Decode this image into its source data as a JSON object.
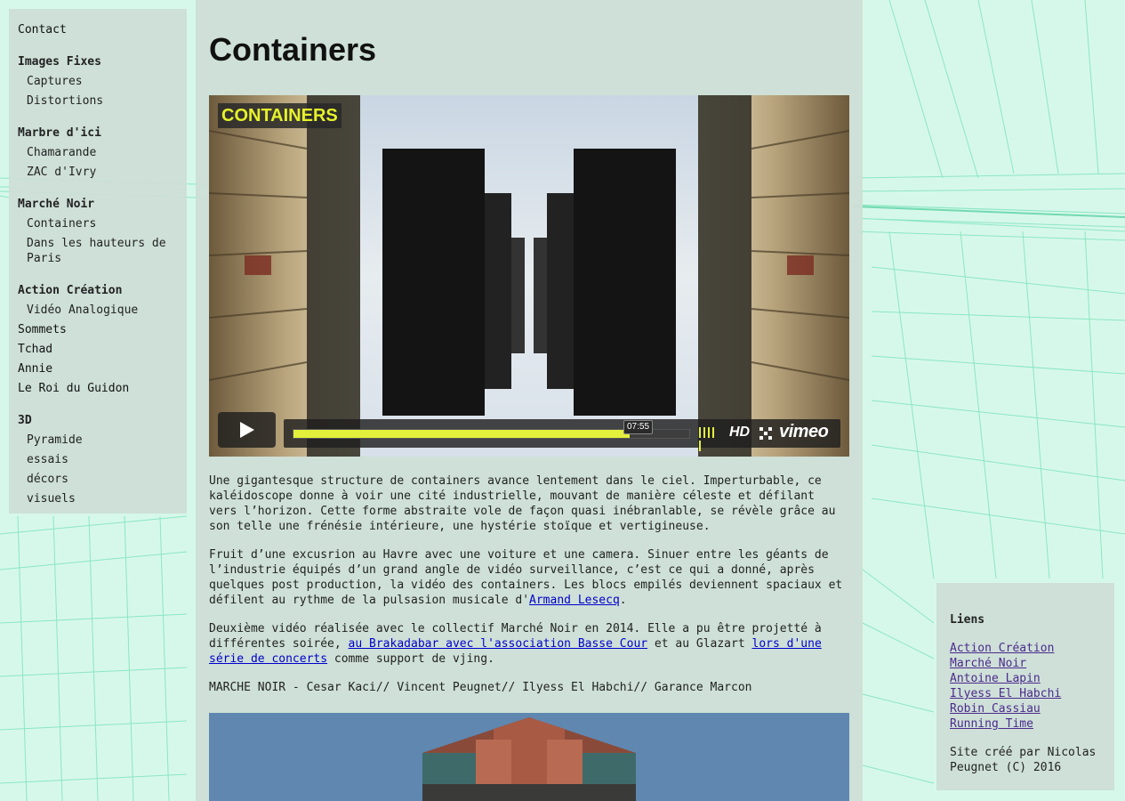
{
  "nav": {
    "contact": "Contact",
    "groups": [
      {
        "label": "Images Fixes",
        "items": [
          "Captures",
          "Distortions"
        ]
      },
      {
        "label": "Marbre d'ici",
        "items": [
          "Chamarande",
          "ZAC d'Ivry"
        ]
      },
      {
        "label": "Marché Noir",
        "items": [
          "Containers",
          "Dans les hauteurs de Paris"
        ]
      },
      {
        "label": "Action Création",
        "items": [
          "Vidéo Analogique"
        ]
      }
    ],
    "standalone": [
      "Sommets",
      "Tchad",
      "Annie",
      "Le Roi du Guidon"
    ],
    "group_3d": {
      "label": "3D",
      "items": [
        "Pyramide",
        "essais",
        "décors",
        "visuels"
      ]
    }
  },
  "main": {
    "title": "Containers",
    "video": {
      "label": "CONTAINERS",
      "time": "07:55",
      "progress": 0.85,
      "hd": "HD",
      "brand": "vimeo"
    },
    "paragraphs": {
      "p1": "Une gigantesque structure de containers avance lentement dans le ciel. Imperturbable, ce kaléidoscope donne à voir une cité industrielle, mouvant de manière céleste et défilant vers l’horizon. Cette forme abstraite vole de façon quasi inébranlable, se révèle grâce au son telle une frénésie intérieure, une hystérie stoïque et vertigineuse.",
      "p2_text": "Fruit d’une excusrion au Havre avec une voiture et une camera. Sinuer entre les géants de l’industrie équipés d’un grand angle de vidéo surveillance, c’est ce qui a donné, après quelques post production, la vidéo des containers. Les blocs empilés deviennent spaciaux et défilent au rythme de la pulsasion musicale d'",
      "p2_link": "Armand Lesecq",
      "p2_end": ".",
      "p3_a": "Deuxième vidéo réalisée avec le collectif Marché Noir en 2014. Elle a pu être projetté à différentes soirée, ",
      "p3_link1": "au Brakadabar avec l'association Basse Cour",
      "p3_b": " et au Glazart ",
      "p3_link2": "lors d'une série de concerts",
      "p3_c": " comme support de vjing.",
      "credits": "MARCHE NOIR - Cesar Kaci// Vincent Peugnet// Ilyess El Habchi// Garance Marcon"
    }
  },
  "sidebar": {
    "title": "Liens",
    "links": [
      "Action Création",
      "Marché Noir",
      "Antoine Lapin",
      "Ilyess El Habchi",
      "Robin Cassiau",
      "Running Time"
    ],
    "footer": "Site créé par Nicolas Peugnet (C) 2016"
  },
  "colors": {
    "background": "#d6f8ea",
    "panel": "#cddfd6",
    "accent_yellow": "#e2f03c",
    "link": "#0000cc"
  }
}
